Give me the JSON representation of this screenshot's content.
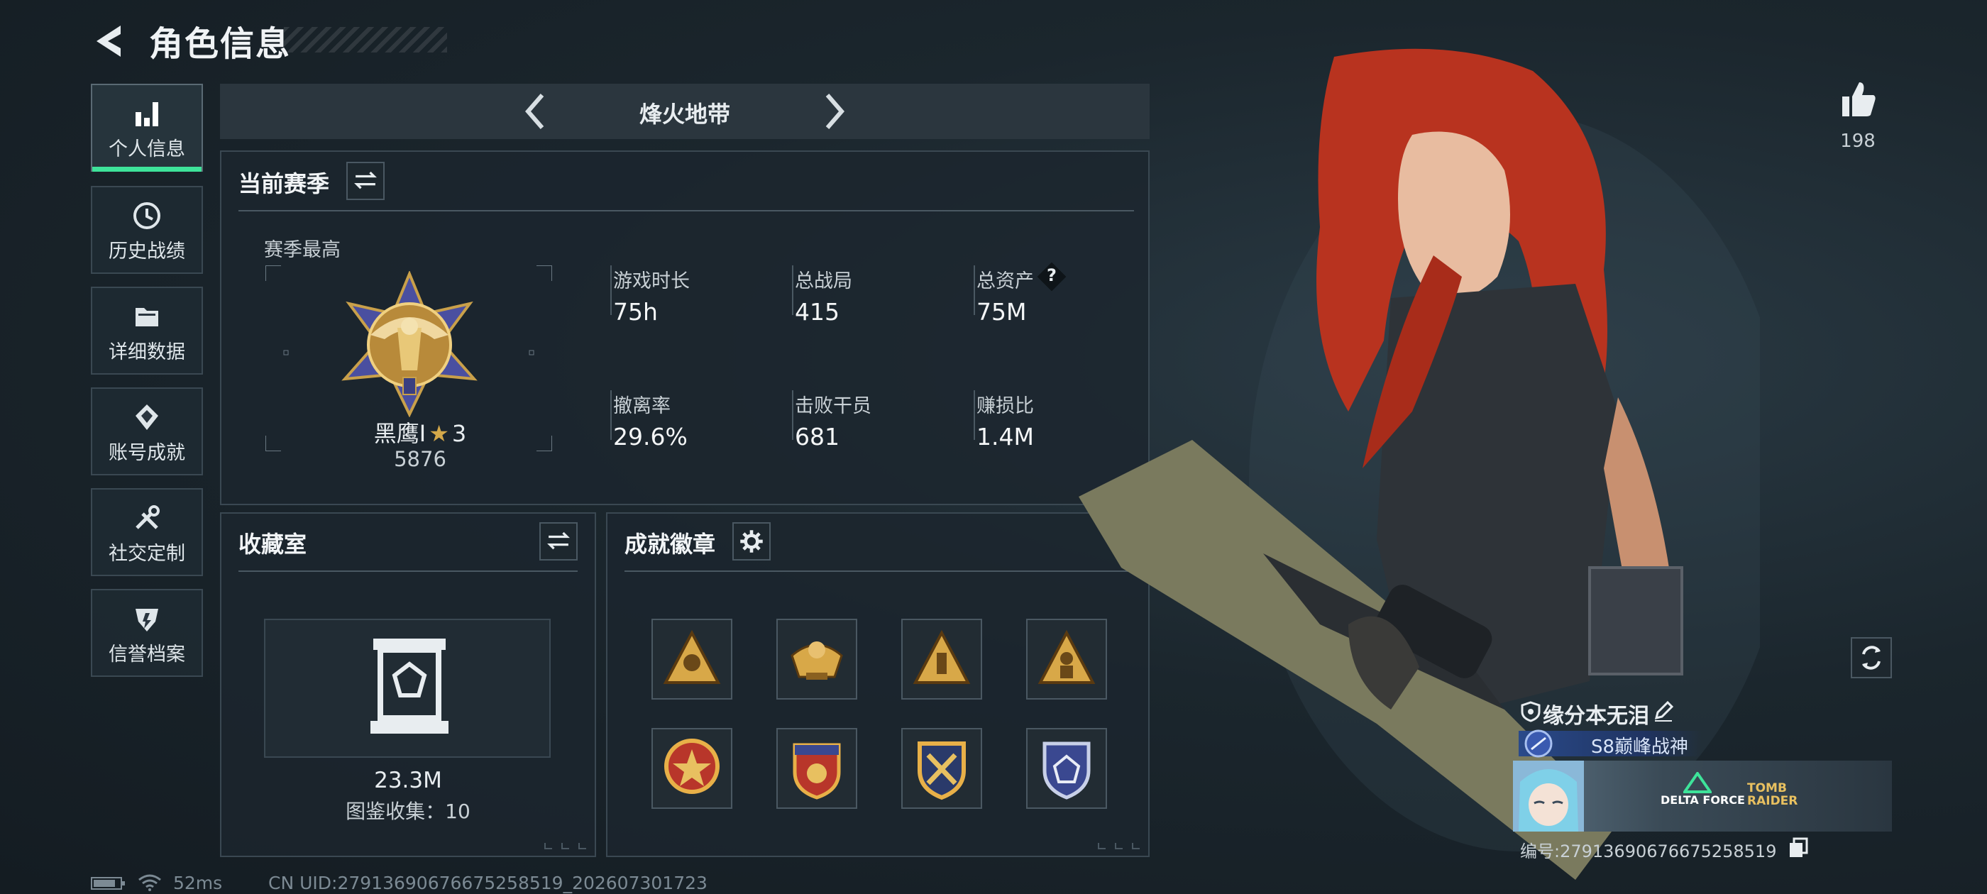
{
  "header": {
    "title": "角色信息"
  },
  "sidebar": {
    "items": [
      {
        "label": "个人信息",
        "icon": "bar-chart-icon",
        "active": true
      },
      {
        "label": "历史战绩",
        "icon": "clock-icon"
      },
      {
        "label": "详细数据",
        "icon": "folder-icon"
      },
      {
        "label": "账号成就",
        "icon": "achievement-icon"
      },
      {
        "label": "社交定制",
        "icon": "tools-icon"
      },
      {
        "label": "信誉档案",
        "icon": "reputation-icon"
      }
    ]
  },
  "mode_tabs": {
    "current": "烽火地带"
  },
  "season": {
    "title": "当前赛季",
    "best_label": "赛季最高",
    "rank_name": "黑鹰Ⅰ",
    "rank_stars": "3",
    "rank_points": "5876",
    "stats": [
      {
        "label": "游戏时长",
        "value": "75h"
      },
      {
        "label": "总战局",
        "value": "415"
      },
      {
        "label": "总资产",
        "value": "75M",
        "help": "?"
      },
      {
        "label": "撤离率",
        "value": "29.6%"
      },
      {
        "label": "击败干员",
        "value": "681"
      },
      {
        "label": "赚损比",
        "value": "1.4M"
      }
    ]
  },
  "collection": {
    "title": "收藏室",
    "value": "23.3M",
    "codex": "图鉴收集：10"
  },
  "achievements": {
    "title": "成就徽章",
    "badge_count": 8
  },
  "likes": {
    "count": "198"
  },
  "profile": {
    "name": "缘分本无泪",
    "title": "S8巅峰战神",
    "banner_logos": [
      "DELTA FORCE",
      "TOMB RAIDER"
    ],
    "id_line": "编号:27913690676675258519"
  },
  "footer": {
    "ping": "52ms",
    "uid": "CN UID:27913690676675258519_202607301723"
  },
  "colors": {
    "accent": "#3ee39a",
    "gold": "#c9a04a",
    "hair": "#b8331f"
  }
}
